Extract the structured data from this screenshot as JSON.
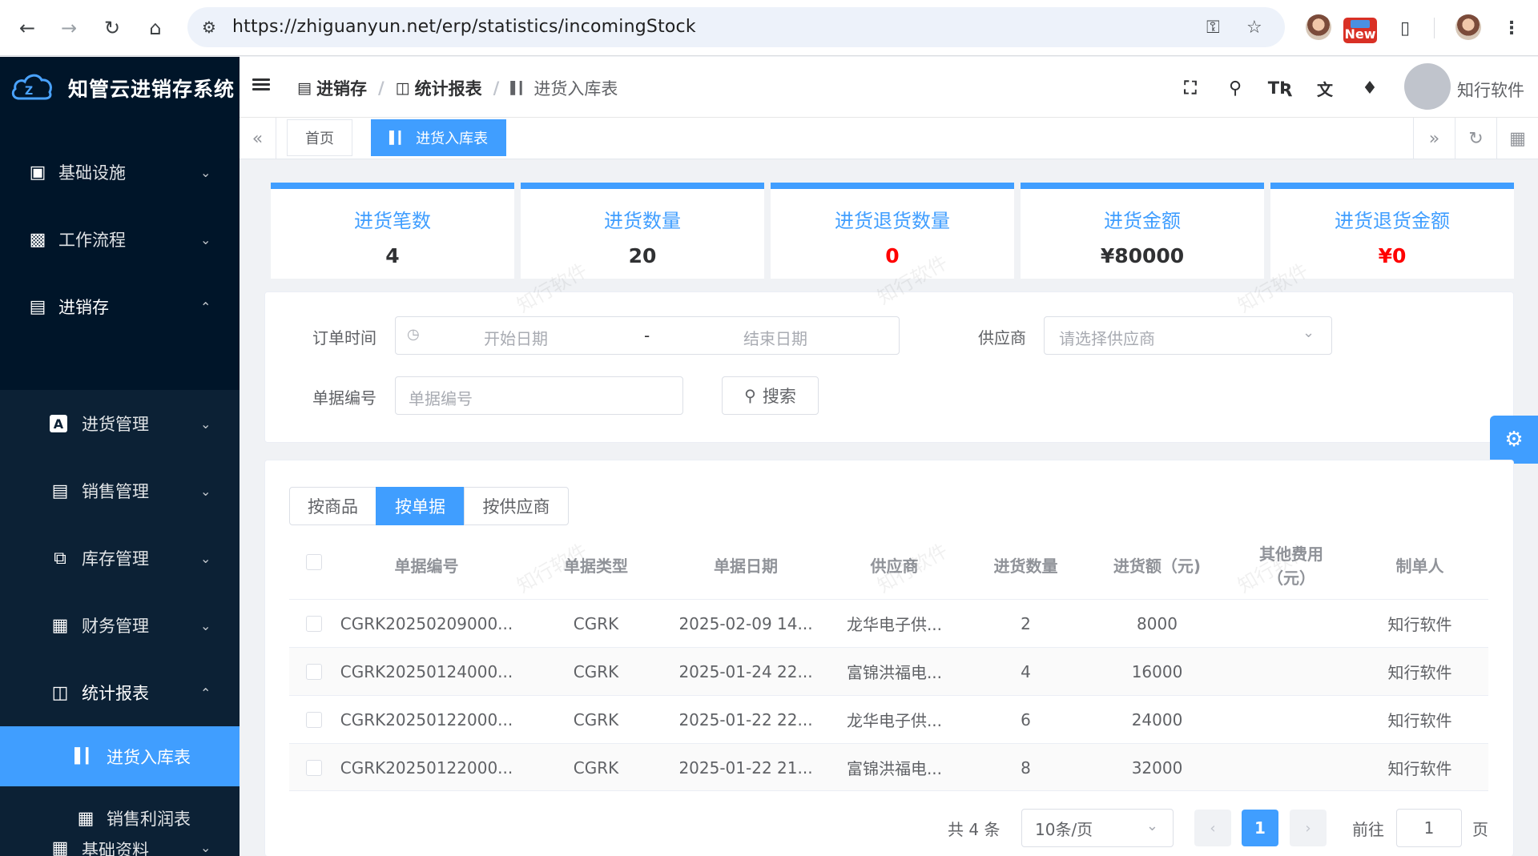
{
  "browser": {
    "url": "https://zhiguanyun.net/erp/statistics/incomingStock",
    "new_badge": "New"
  },
  "sidebar": {
    "app_title": "知管云进销存系统",
    "items": [
      {
        "label": "基础设施",
        "icon": "monitor-icon"
      },
      {
        "label": "工作流程",
        "icon": "workflow-icon"
      },
      {
        "label": "进销存",
        "icon": "store-icon"
      },
      {
        "label": "进货管理",
        "icon": "letter-a-icon"
      },
      {
        "label": "销售管理",
        "icon": "document-icon"
      },
      {
        "label": "库存管理",
        "icon": "inventory-icon"
      },
      {
        "label": "财务管理",
        "icon": "finance-icon"
      },
      {
        "label": "统计报表",
        "icon": "report-icon"
      },
      {
        "label": "进货入库表",
        "icon": "bar-chart-icon"
      },
      {
        "label": "销售利润表",
        "icon": "finance-icon"
      },
      {
        "label": "基础资料",
        "icon": "grid-icon"
      }
    ]
  },
  "header": {
    "breadcrumb": [
      "进销存",
      "统计报表",
      "进货入库表"
    ],
    "user_name": "知行软件"
  },
  "tags": {
    "home": "首页",
    "current": "进货入库表"
  },
  "stats": [
    {
      "title": "进货笔数",
      "value": "4"
    },
    {
      "title": "进货数量",
      "value": "20"
    },
    {
      "title": "进货退货数量",
      "value": "0"
    },
    {
      "title": "进货金额",
      "value": "¥80000"
    },
    {
      "title": "进货退货金额",
      "value": "¥0"
    }
  ],
  "stat_colors": {
    "accent": "#409eff",
    "negative": "#ff0000"
  },
  "search": {
    "order_time_label": "订单时间",
    "start_placeholder": "开始日期",
    "range_sep": "-",
    "end_placeholder": "结束日期",
    "supplier_label": "供应商",
    "supplier_placeholder": "请选择供应商",
    "doc_no_label": "单据编号",
    "doc_no_placeholder": "单据编号",
    "search_button": "搜索"
  },
  "view_tabs": [
    "按商品",
    "按单据",
    "按供应商"
  ],
  "table": {
    "columns": [
      "单据编号",
      "单据类型",
      "单据日期",
      "供应商",
      "进货数量",
      "进货额（元)",
      "其他费用（元）",
      "制单人"
    ],
    "rows": [
      [
        "CGRK20250209000...",
        "CGRK",
        "2025-02-09 14...",
        "龙华电子供...",
        "2",
        "8000",
        "",
        "知行软件"
      ],
      [
        "CGRK20250124000...",
        "CGRK",
        "2025-01-24 22...",
        "富锦洪福电...",
        "4",
        "16000",
        "",
        "知行软件"
      ],
      [
        "CGRK20250122000...",
        "CGRK",
        "2025-01-22 22...",
        "龙华电子供...",
        "6",
        "24000",
        "",
        "知行软件"
      ],
      [
        "CGRK20250122000...",
        "CGRK",
        "2025-01-22 21...",
        "富锦洪福电...",
        "8",
        "32000",
        "",
        "知行软件"
      ]
    ]
  },
  "pagination": {
    "total": "共 4 条",
    "page_size": "10条/页",
    "current_page": "1",
    "goto_label": "前往",
    "goto_value": "1",
    "page_suffix": "页"
  },
  "watermark": "知行软件"
}
